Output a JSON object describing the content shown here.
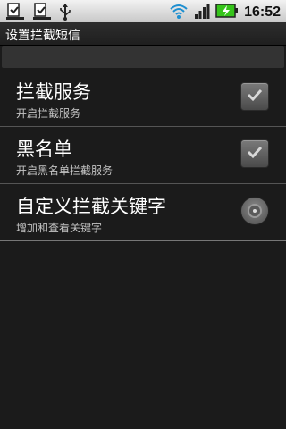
{
  "status_bar": {
    "time": "16:52",
    "icons": [
      "download-icon",
      "download-icon",
      "usb-icon",
      "wifi-icon",
      "signal-icon",
      "battery-charging-icon"
    ]
  },
  "title_bar": {
    "title": "设置拦截短信"
  },
  "settings": {
    "items": [
      {
        "title": "拦截服务",
        "summary": "开启拦截服务",
        "control": "checkbox",
        "checked": true
      },
      {
        "title": "黑名单",
        "summary": "开启黑名单拦截服务",
        "control": "checkbox",
        "checked": true
      },
      {
        "title": "自定义拦截关键字",
        "summary": "增加和查看关键字",
        "control": "dropdown-radio"
      }
    ]
  },
  "colors": {
    "background": "#1b1b1b",
    "status_bar": "#dcdcdc",
    "summary_text": "#c4c4c4",
    "battery_green": "#35c41a"
  }
}
